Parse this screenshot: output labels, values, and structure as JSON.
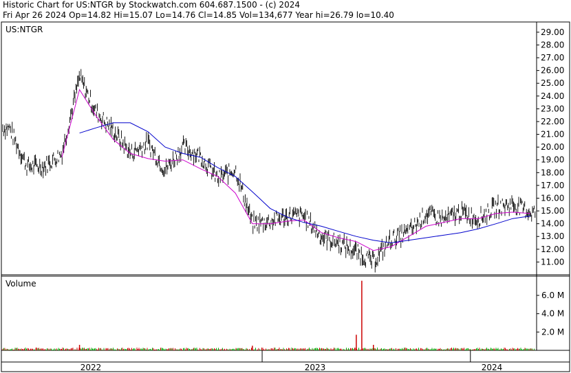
{
  "header": {
    "line1": "Historic Chart for US:NTGR by Stockwatch.com 604.687.1500 - (c) 2024",
    "line2": "Fri Apr 26 2024   Op=14.82   Hi=15.07   Lo=14.76   Cl=14.85   Vol=134,677   Year hi=26.79   lo=10.40"
  },
  "price_pane": {
    "label": "US:NTGR"
  },
  "volume_pane": {
    "label": "Volume"
  },
  "years": [
    "2022",
    "2023",
    "2024"
  ],
  "colors": {
    "price": "#000000",
    "ma_short": "#cc00cc",
    "ma_long": "#0000cc",
    "vol_up": "#00aa00",
    "vol_down": "#cc0000"
  },
  "chart_data": [
    {
      "type": "line",
      "title": "US:NTGR",
      "ylim": [
        10,
        29.8
      ],
      "y_ticks": [
        "11.00",
        "12.00",
        "13.00",
        "14.00",
        "15.00",
        "16.00",
        "17.00",
        "18.00",
        "19.00",
        "20.00",
        "21.00",
        "22.00",
        "23.00",
        "24.00",
        "25.00",
        "26.00",
        "27.00",
        "28.00",
        "29.00"
      ],
      "x_ticks": [
        "2022",
        "2023",
        "2024"
      ],
      "series": [
        {
          "key": "close",
          "x": [
            "2021-10",
            "2021-11",
            "2021-12",
            "2022-01",
            "2022-02",
            "2022-03",
            "2022-04",
            "2022-05",
            "2022-06",
            "2022-07",
            "2022-08",
            "2022-09",
            "2022-10",
            "2022-11",
            "2022-12",
            "2023-01",
            "2023-02",
            "2023-03",
            "2023-04",
            "2023-05",
            "2023-06",
            "2023-07",
            "2023-08",
            "2023-09",
            "2023-10",
            "2023-11",
            "2023-12",
            "2024-01",
            "2024-02",
            "2024-03",
            "2024-04"
          ],
          "y": [
            21.5,
            18.5,
            18.5,
            19.5,
            25.5,
            22.8,
            21.3,
            19.5,
            20.3,
            18.2,
            20.0,
            19.3,
            17.5,
            18.3,
            14.0,
            14.2,
            14.6,
            14.6,
            13.0,
            12.5,
            11.8,
            11.0,
            12.8,
            13.3,
            14.8,
            14.3,
            14.9,
            14.4,
            15.3,
            15.5,
            14.9
          ]
        },
        {
          "key": "ma_short",
          "x": [
            "2022-01",
            "2022-02",
            "2022-03",
            "2022-04",
            "2022-05",
            "2022-06",
            "2022-07",
            "2022-08",
            "2022-09",
            "2022-10",
            "2022-11",
            "2022-12",
            "2023-01",
            "2023-02",
            "2023-03",
            "2023-04",
            "2023-05",
            "2023-06",
            "2023-07",
            "2023-08",
            "2023-09",
            "2023-10",
            "2023-11",
            "2023-12",
            "2024-01",
            "2024-02",
            "2024-03",
            "2024-04"
          ],
          "y": [
            19.2,
            24.5,
            22.5,
            20.6,
            19.5,
            19.1,
            18.9,
            19.0,
            18.3,
            17.7,
            16.4,
            14.0,
            14.0,
            14.2,
            14.3,
            13.3,
            12.9,
            12.6,
            11.9,
            12.2,
            13.0,
            13.8,
            14.1,
            14.4,
            14.4,
            14.8,
            14.9,
            14.8
          ]
        },
        {
          "key": "ma_long",
          "x": [
            "2022-02",
            "2022-03",
            "2022-04",
            "2022-05",
            "2022-06",
            "2022-07",
            "2022-08",
            "2022-09",
            "2022-10",
            "2022-11",
            "2022-12",
            "2023-01",
            "2023-02",
            "2023-03",
            "2023-04",
            "2023-05",
            "2023-06",
            "2023-07",
            "2023-08",
            "2023-09",
            "2023-10",
            "2023-11",
            "2023-12",
            "2024-01",
            "2024-02",
            "2024-03",
            "2024-04"
          ],
          "y": [
            21.1,
            21.5,
            21.9,
            21.9,
            21.2,
            20.0,
            19.5,
            19.2,
            18.4,
            17.7,
            16.5,
            15.2,
            14.5,
            14.1,
            13.8,
            13.4,
            13.0,
            12.7,
            12.5,
            12.7,
            12.9,
            13.1,
            13.3,
            13.6,
            14.0,
            14.4,
            14.6
          ]
        }
      ]
    },
    {
      "type": "bar",
      "title": "Volume",
      "ylim": [
        0,
        8.1
      ],
      "y_ticks": [
        "2.0 M",
        "4.0 M",
        "6.0 M"
      ],
      "series": [
        {
          "key": "volume_spikes",
          "x": [
            "2022-02",
            "2022-12",
            "2023-06",
            "2023-06",
            "2023-07"
          ],
          "values": [
            0.6,
            0.5,
            1.7,
            7.6,
            0.6
          ]
        }
      ]
    }
  ]
}
